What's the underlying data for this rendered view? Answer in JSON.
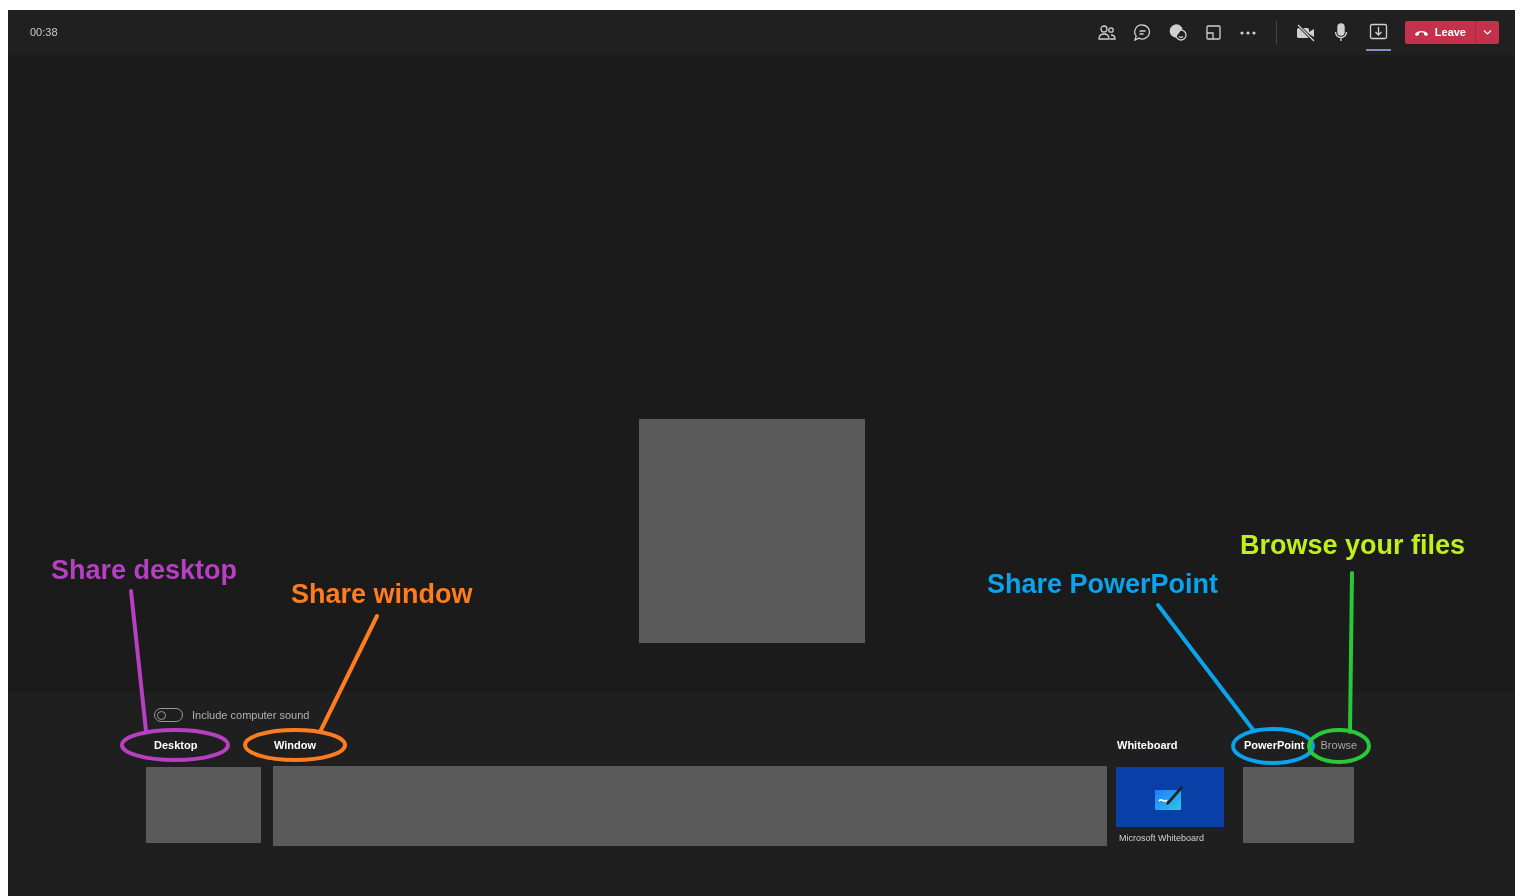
{
  "call_bar": {
    "timer": "00:38",
    "camera_on": false,
    "share_selected": true,
    "leave_button": {
      "label": "Leave"
    }
  },
  "share_tray": {
    "sound_toggle": {
      "label": "Include computer sound",
      "on": false
    },
    "desktop": {
      "heading": "Desktop"
    },
    "window": {
      "heading": "Window"
    },
    "whiteboard": {
      "heading": "Whiteboard",
      "tile_label": "Microsoft Whiteboard"
    },
    "powerpoint": {
      "heading": "PowerPoint",
      "browse_link": "Browse"
    }
  },
  "annotations": [
    {
      "text": "Share desktop",
      "color": "#b63fc2",
      "marker": {
        "color": "#b63fc2"
      }
    },
    {
      "text": "Share window",
      "color": "#ff7d1f",
      "marker": {
        "color": "#ff7d1f"
      }
    },
    {
      "text": "Share PowerPoint",
      "color": "#0aa3ec",
      "marker": {
        "color": "#0aa3ec"
      }
    },
    {
      "text": "Browse your files",
      "color": "#bff01a",
      "marker": {
        "color": "#27c93a"
      }
    }
  ]
}
